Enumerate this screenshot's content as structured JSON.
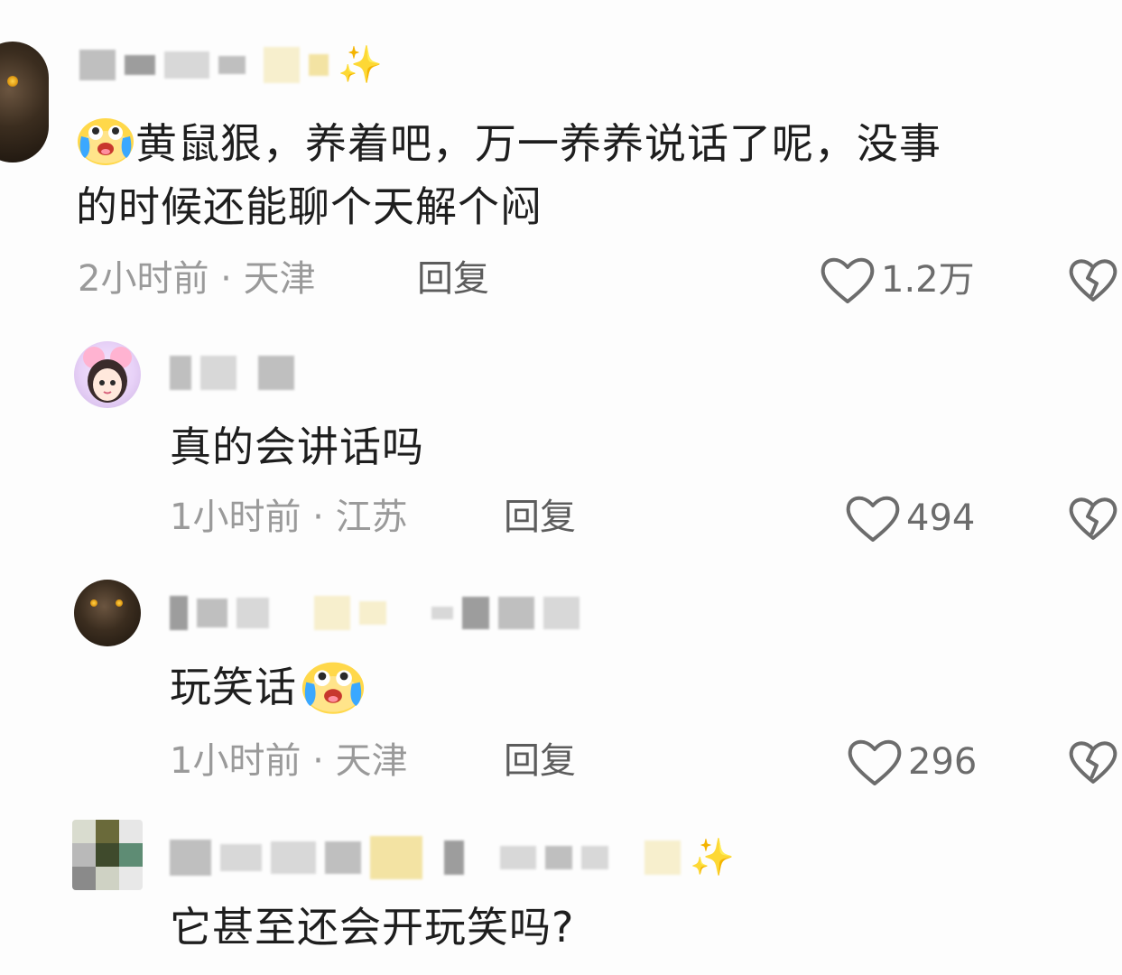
{
  "comments": [
    {
      "text_line1": "黄鼠狠，养着吧，万一养养说话了呢，没事",
      "text_line2": "的时候还能聊个天解个闷",
      "time": "2小时前",
      "location": "天津",
      "reply_label": "回复",
      "likes": "1.2万",
      "emoji_name": "laughing-crying-emoji"
    },
    {
      "text": "真的会讲话吗",
      "time": "1小时前",
      "location": "江苏",
      "reply_label": "回复",
      "likes": "494"
    },
    {
      "text": "玩笑话",
      "time": "1小时前",
      "location": "天津",
      "reply_label": "回复",
      "likes": "296",
      "emoji_name": "laughing-crying-emoji"
    },
    {
      "text": "它甚至还会开玩笑吗?"
    }
  ],
  "meta_separator": " · ",
  "icons": {
    "like": "heart-outline-icon",
    "dislike": "broken-heart-icon",
    "sparkle": "sparkle-icon"
  },
  "colors": {
    "text": "#1e1e1e",
    "meta": "#9a9a9a",
    "reply": "#5c5c5c",
    "icon": "#6c6c6c",
    "background": "#fdfdfd"
  }
}
